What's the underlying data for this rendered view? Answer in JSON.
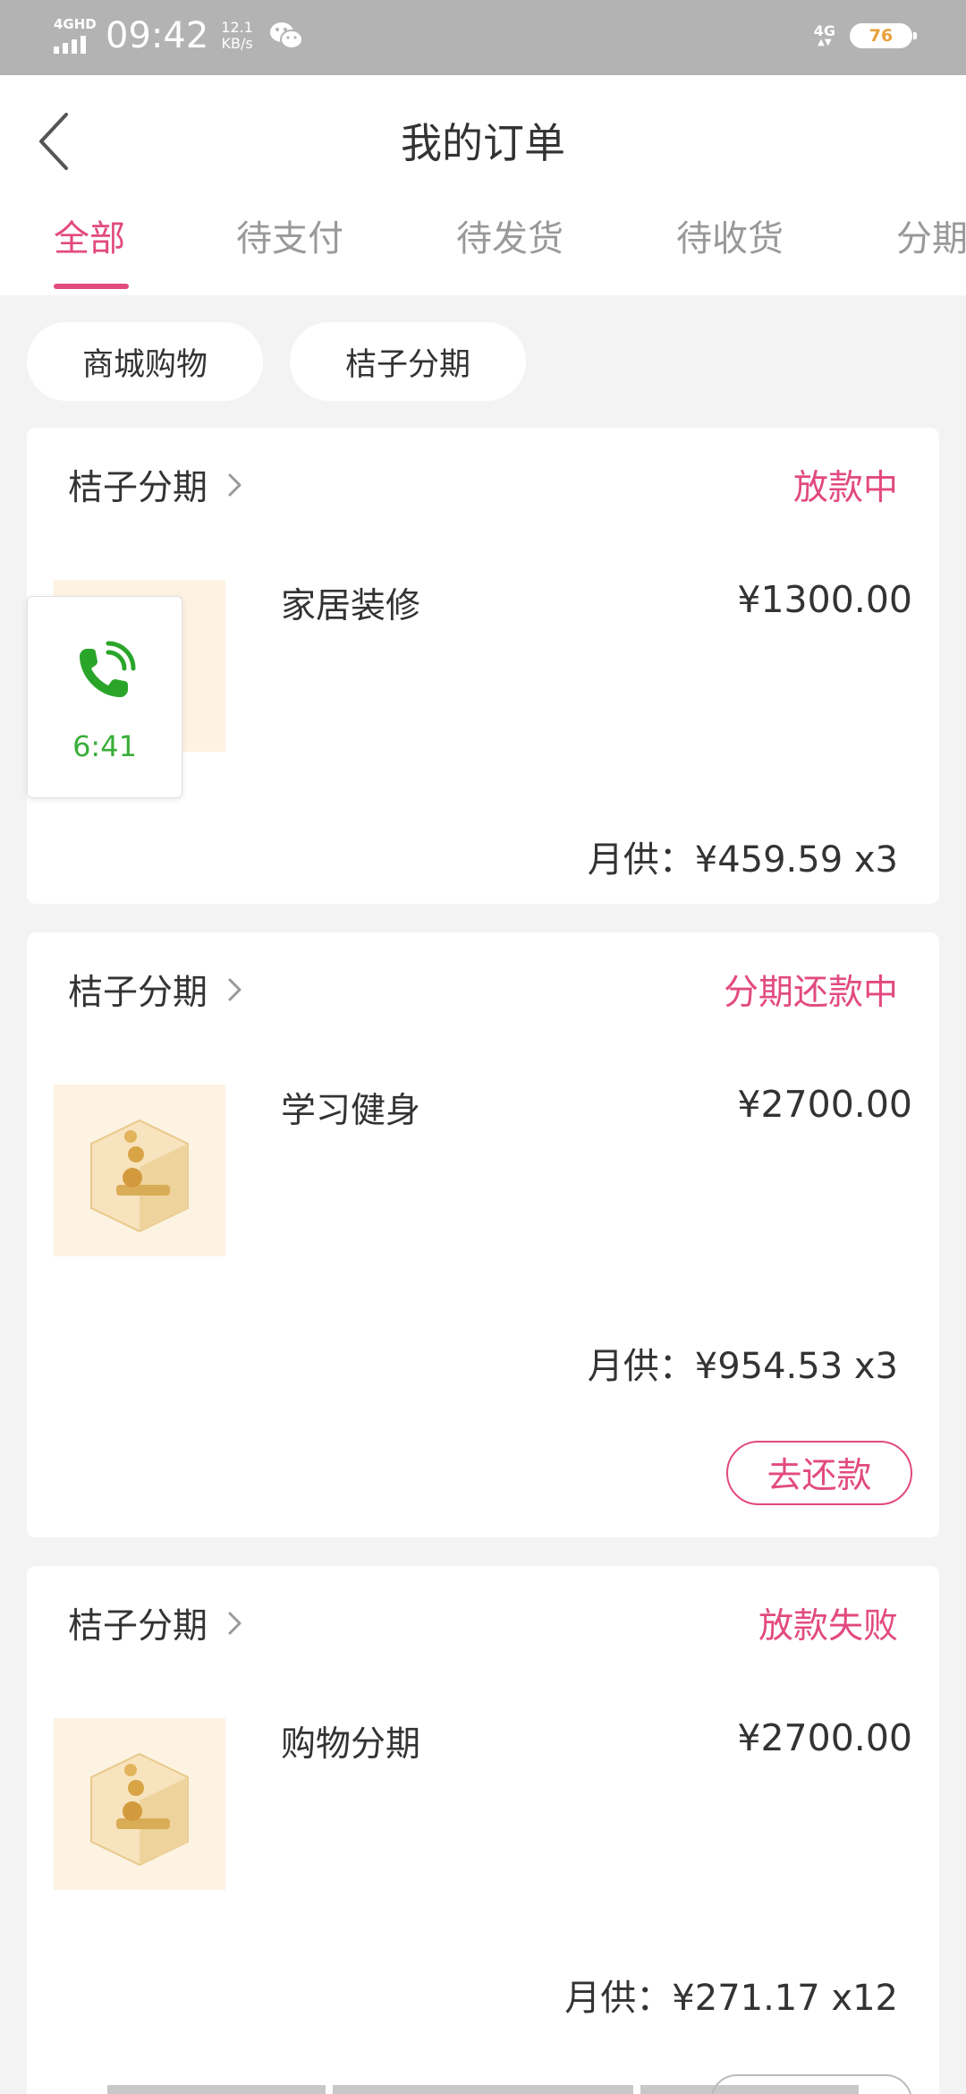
{
  "status_bar": {
    "network": "4GHD",
    "time": "09:42",
    "speed_value": "12.1",
    "speed_unit": "KB/s",
    "mobile": "4G",
    "battery": "76"
  },
  "header": {
    "title": "我的订单"
  },
  "tabs": [
    {
      "label": "全部",
      "active": true
    },
    {
      "label": "待支付"
    },
    {
      "label": "待发货"
    },
    {
      "label": "待收货"
    },
    {
      "label": "分期"
    }
  ],
  "filters": [
    {
      "label": "商城购物"
    },
    {
      "label": "桔子分期"
    }
  ],
  "orders": [
    {
      "kind": "桔子分期",
      "status": "放款中",
      "name": "家居装修",
      "price": "¥1300.00",
      "monthly": "月供：¥459.59 x3"
    },
    {
      "kind": "桔子分期",
      "status": "分期还款中",
      "name": "学习健身",
      "price": "¥2700.00",
      "monthly": "月供：¥954.53 x3",
      "action": "去还款"
    },
    {
      "kind": "桔子分期",
      "status": "放款失败",
      "name": "购物分期",
      "price": "¥2700.00",
      "monthly": "月供：¥271.17 x12"
    }
  ],
  "call_widget": {
    "duration": "6:41"
  },
  "colors": {
    "accent": "#e24a80",
    "call_green": "#3aae3a",
    "status_bar": "#b3b3b3",
    "background": "#f3f3f3"
  }
}
